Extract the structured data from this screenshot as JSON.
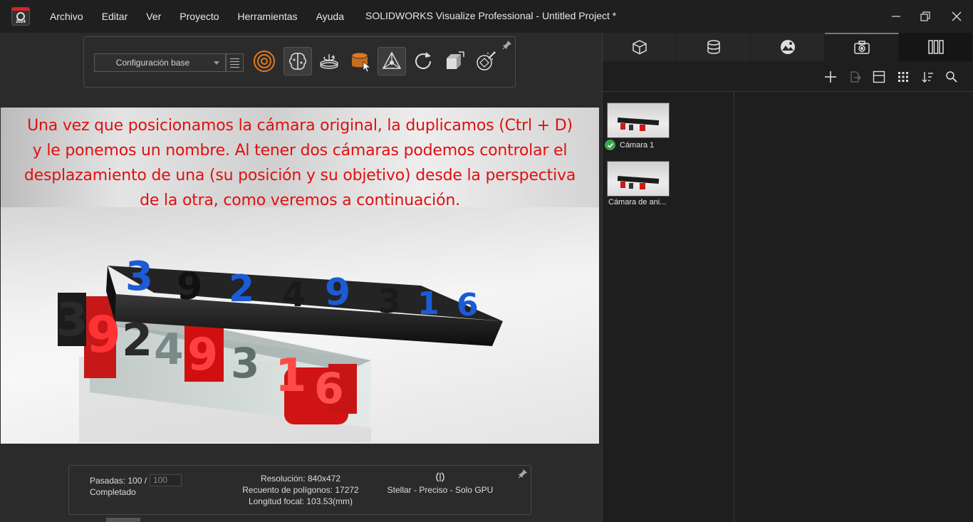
{
  "app": {
    "logo_year": "2024",
    "title": "SOLIDWORKS Visualize Professional - Untitled Project *"
  },
  "menu": [
    "Archivo",
    "Editar",
    "Ver",
    "Proyecto",
    "Herramientas",
    "Ayuda"
  ],
  "toolbar": {
    "config_value": "Configuración base",
    "tools": [
      "target-icon",
      "brain-icon",
      "turntable-icon",
      "object-edit-icon",
      "triad-icon",
      "refresh-icon",
      "scale-icon",
      "magic-wand-icon"
    ]
  },
  "viewport": {
    "caption_lines": [
      "Una vez que posicionamos la cámara original, la duplicamos (Ctrl + D)",
      "y le ponemos un nombre. Al tener dos cámaras podemos controlar el",
      "desplazamiento de una (su posición y su objetivo) desde la perspectiva",
      "de la otra, como veremos a continuación."
    ],
    "top_bar_digits": [
      "3",
      "9",
      "2",
      "4",
      "9",
      "3",
      "1",
      "6"
    ],
    "front_digits": [
      "3",
      "9",
      "2",
      "4",
      "9",
      "3",
      "1",
      "6"
    ]
  },
  "status": {
    "passes_label": "Pasadas: 100 /",
    "passes_max": "100",
    "state": "Completado",
    "resolution": "Resolución: 840x472",
    "polygons": "Recuento de polígonos: 17272",
    "focal": "Longitud focal: 103.53(mm)",
    "render_mode": "Stellar - Preciso - Solo GPU"
  },
  "right_panel": {
    "tabs": [
      "cube-icon",
      "database-icon",
      "image-icon",
      "camera-icon",
      "columns-icon"
    ],
    "active_tab": 3,
    "actions": [
      "plus-icon",
      "export-icon",
      "layout-icon",
      "grid-icon",
      "sort-icon",
      "search-icon"
    ],
    "cameras": [
      {
        "label": "Cámara 1",
        "active": true
      },
      {
        "label": "Cámara de ani...",
        "active": false
      }
    ]
  },
  "colors": {
    "caption_red": "#e10f0f",
    "accent_orange": "#e07a1e",
    "check_green": "#3aa54a",
    "digit_blue": "#1d5bd6"
  }
}
